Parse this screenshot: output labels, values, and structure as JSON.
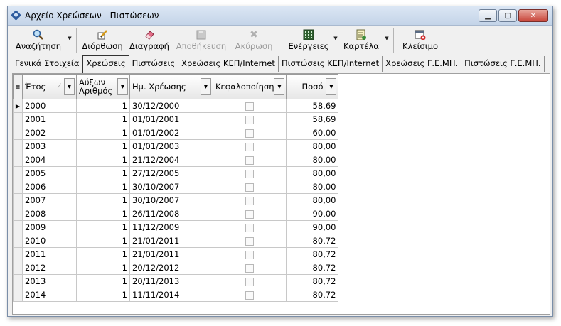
{
  "window": {
    "title": "Αρχείο Χρεώσεων - Πιστώσεων",
    "minimize": "▁",
    "maximize": "▢",
    "close": "✕"
  },
  "toolbar": {
    "search": "Αναζήτηση",
    "edit": "Διόρθωση",
    "delete": "Διαγραφή",
    "save": "Αποθήκευση",
    "cancel": "Ακύρωση",
    "actions": "Ενέργειες",
    "card": "Καρτέλα",
    "close": "Κλείσιμο"
  },
  "tabs": [
    "Γενικά Στοιχεία",
    "Χρεώσεις",
    "Πιστώσεις",
    "Χρεώσεις ΚΕΠ/Internet",
    "Πιστώσεις ΚΕΠ/Internet",
    "Χρεώσεις Γ.Ε.ΜΗ.",
    "Πιστώσεις Γ.Ε.ΜΗ."
  ],
  "active_tab": "Χρεώσεις",
  "table": {
    "columns": [
      "Έτος",
      "Αύξων Αριθμός",
      "Ημ. Χρέωσης",
      "Κεφαλοποίηση",
      "Ποσό"
    ],
    "rows": [
      [
        "2000",
        "1",
        "30/12/2000",
        "58,69"
      ],
      [
        "2001",
        "1",
        "01/01/2001",
        "58,69"
      ],
      [
        "2002",
        "1",
        "01/01/2002",
        "60,00"
      ],
      [
        "2003",
        "1",
        "01/01/2003",
        "80,00"
      ],
      [
        "2004",
        "1",
        "21/12/2004",
        "80,00"
      ],
      [
        "2005",
        "1",
        "27/12/2005",
        "80,00"
      ],
      [
        "2006",
        "1",
        "30/10/2007",
        "80,00"
      ],
      [
        "2007",
        "1",
        "30/10/2007",
        "80,00"
      ],
      [
        "2008",
        "1",
        "26/11/2008",
        "90,00"
      ],
      [
        "2009",
        "1",
        "11/12/2009",
        "90,00"
      ],
      [
        "2010",
        "1",
        "21/01/2011",
        "80,72"
      ],
      [
        "2011",
        "1",
        "21/01/2011",
        "80,72"
      ],
      [
        "2012",
        "1",
        "20/12/2012",
        "80,72"
      ],
      [
        "2013",
        "1",
        "20/11/2013",
        "80,72"
      ],
      [
        "2014",
        "1",
        "11/11/2014",
        "80,72"
      ]
    ]
  }
}
